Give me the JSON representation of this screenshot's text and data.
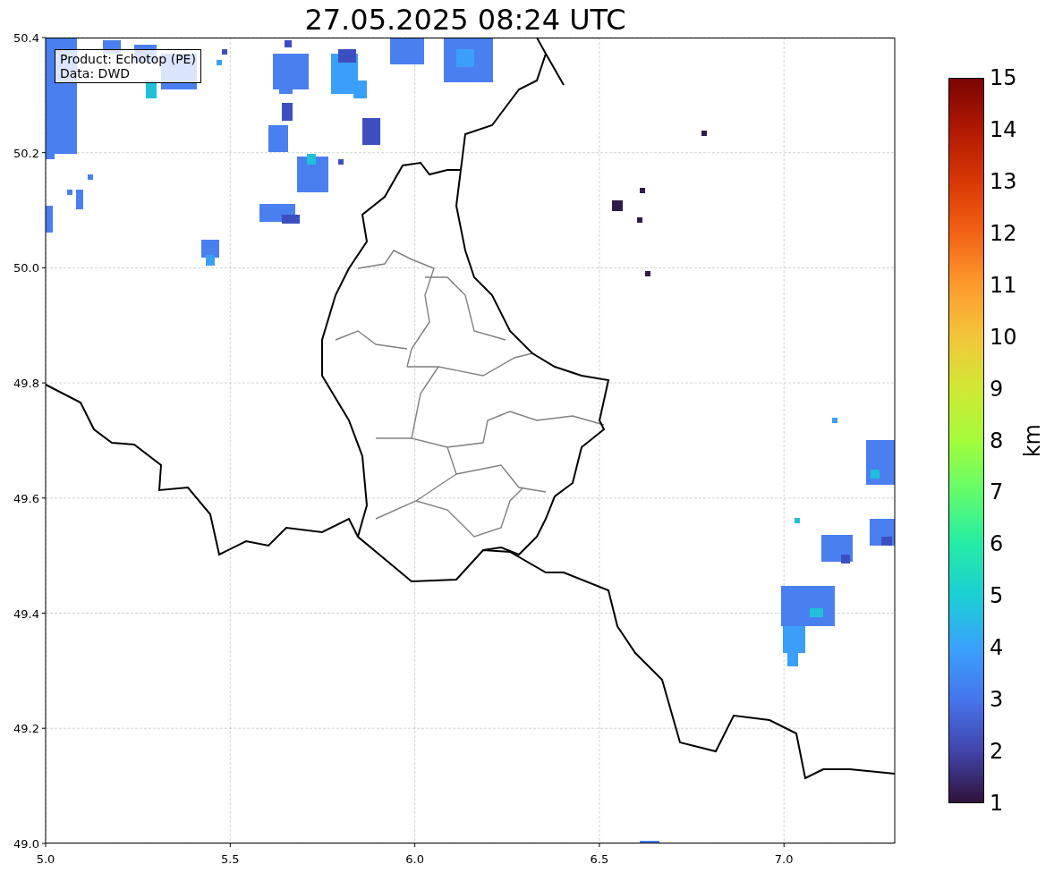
{
  "title": "27.05.2025 08:24 UTC",
  "map": {
    "legend": [
      "Product: Echotop (PE)",
      "Data: DWD"
    ],
    "xticks": [
      "5.0",
      "5.5",
      "6.0",
      "6.5",
      "7.0"
    ],
    "yticks": [
      "50.4",
      "50.2",
      "50.0",
      "49.8",
      "49.6",
      "49.4",
      "49.2",
      "49.0"
    ]
  },
  "colorbar": {
    "label": "km",
    "ticks": [
      "15",
      "14",
      "13",
      "12",
      "11",
      "10",
      "9",
      "8",
      "7",
      "6",
      "5",
      "4",
      "3",
      "2",
      "1"
    ]
  }
}
